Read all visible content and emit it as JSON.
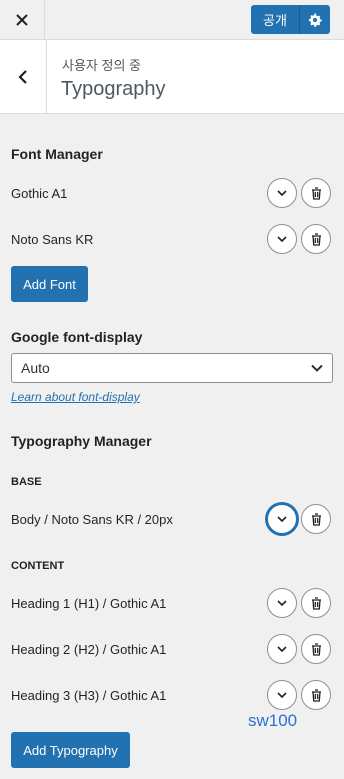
{
  "topbar": {
    "close_icon": "close-icon",
    "publish_label": "공개",
    "settings_icon": "gear-icon"
  },
  "header": {
    "back_icon": "chevron-left-icon",
    "breadcrumb": "사용자 정의 중",
    "title": "Typography"
  },
  "font_manager": {
    "title": "Font Manager",
    "fonts": [
      {
        "label": "Gothic A1"
      },
      {
        "label": "Noto Sans KR"
      }
    ],
    "add_button": "Add Font"
  },
  "font_display": {
    "title": "Google font-display",
    "selected": "Auto",
    "help_link": "Learn about font-display"
  },
  "typography_manager": {
    "title": "Typography Manager",
    "base_label": "BASE",
    "base_items": [
      {
        "label": "Body / Noto Sans KR / 20px"
      }
    ],
    "content_label": "CONTENT",
    "content_items": [
      {
        "label": "Heading 1 (H1) / Gothic A1"
      },
      {
        "label": "Heading 2 (H2) / Gothic A1"
      },
      {
        "label": "Heading 3 (H3) / Gothic A1"
      }
    ],
    "add_button": "Add Typography"
  },
  "watermark": "sw100",
  "colors": {
    "accent": "#2271b1",
    "panel_bg": "#f0f0f1",
    "text": "#1d2327"
  }
}
